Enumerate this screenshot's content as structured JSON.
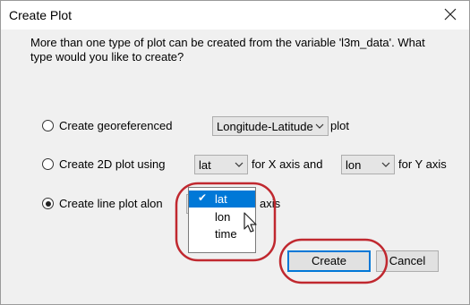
{
  "window": {
    "title": "Create Plot",
    "close_glyph": "✕"
  },
  "prompt": "More than one type of plot can be created from the variable 'l3m_data'. What type would you like to create?",
  "options": {
    "georef": {
      "prefix": "Create georeferenced",
      "combo_value": "Longitude-Latitude",
      "suffix": "plot",
      "checked": false
    },
    "plot2d": {
      "prefix": "Create 2D plot using",
      "x_combo_value": "lat",
      "middle": "for X axis and",
      "y_combo_value": "lon",
      "suffix": "for Y axis",
      "checked": false
    },
    "line": {
      "prefix": "Create line plot alon",
      "combo_value": "lat",
      "suffix": "axis",
      "checked": true
    }
  },
  "dropdown": {
    "items": [
      {
        "label": "lat",
        "selected": true
      },
      {
        "label": "lon",
        "selected": false
      },
      {
        "label": "time",
        "selected": false
      }
    ]
  },
  "buttons": {
    "create": "Create",
    "cancel": "Cancel"
  },
  "colors": {
    "accent": "#0078d7",
    "annotation": "#c0282f"
  },
  "icons": [
    "close-icon",
    "chevron-down-icon",
    "checkmark-icon",
    "mouse-cursor-icon"
  ]
}
